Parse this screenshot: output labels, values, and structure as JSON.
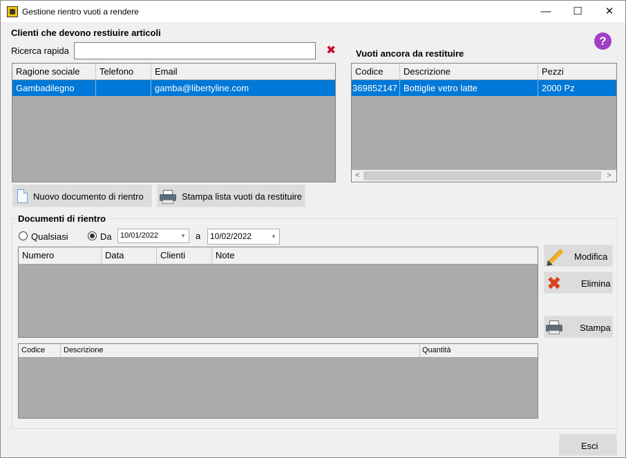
{
  "window": {
    "title": "Gestione rientro vuoti a rendere",
    "minimize_glyph": "—",
    "maximize_glyph": "☐",
    "close_glyph": "✕"
  },
  "help": {
    "glyph": "?"
  },
  "clients": {
    "section_title": "Clienti che devono restiuire articoli",
    "search_label": "Ricerca rapida",
    "search_value": "",
    "clear_glyph": "✖",
    "columns": [
      "Ragione sociale",
      "Telefono",
      "Email"
    ],
    "rows": [
      {
        "ragione_sociale": "Gambadilegno",
        "telefono": "",
        "email": "gamba@libertyline.com"
      }
    ]
  },
  "empties": {
    "section_title": "Vuoti ancora da restituire",
    "columns": [
      "Codice",
      "Descrizione",
      "Pezzi"
    ],
    "rows": [
      {
        "codice": "369852147",
        "descrizione": "Bottiglie vetro latte",
        "pezzi": "2000 Pz"
      }
    ]
  },
  "buttons": {
    "new_document": "Nuovo documento di rientro",
    "print_list": "Stampa lista vuoti da restituire",
    "modify": "Modifica",
    "delete": "Elimina",
    "print": "Stampa",
    "exit": "Esci"
  },
  "documents": {
    "section_title": "Documenti di rientro",
    "filter_any": "Qualsiasi",
    "filter_from": "Da",
    "selected_filter": "from",
    "date_from": "10/01/2022",
    "to_label": "a",
    "date_to": "10/02/2022",
    "columns": [
      "Numero",
      "Data",
      "Clienti",
      "Note"
    ],
    "detail_columns": [
      "Codice",
      "Descrizione",
      "Quantità"
    ]
  },
  "colors": {
    "selection": "#0078d7",
    "grid_background": "#ababab",
    "help_accent": "#a13fc7",
    "delete_red": "#d9431e"
  }
}
